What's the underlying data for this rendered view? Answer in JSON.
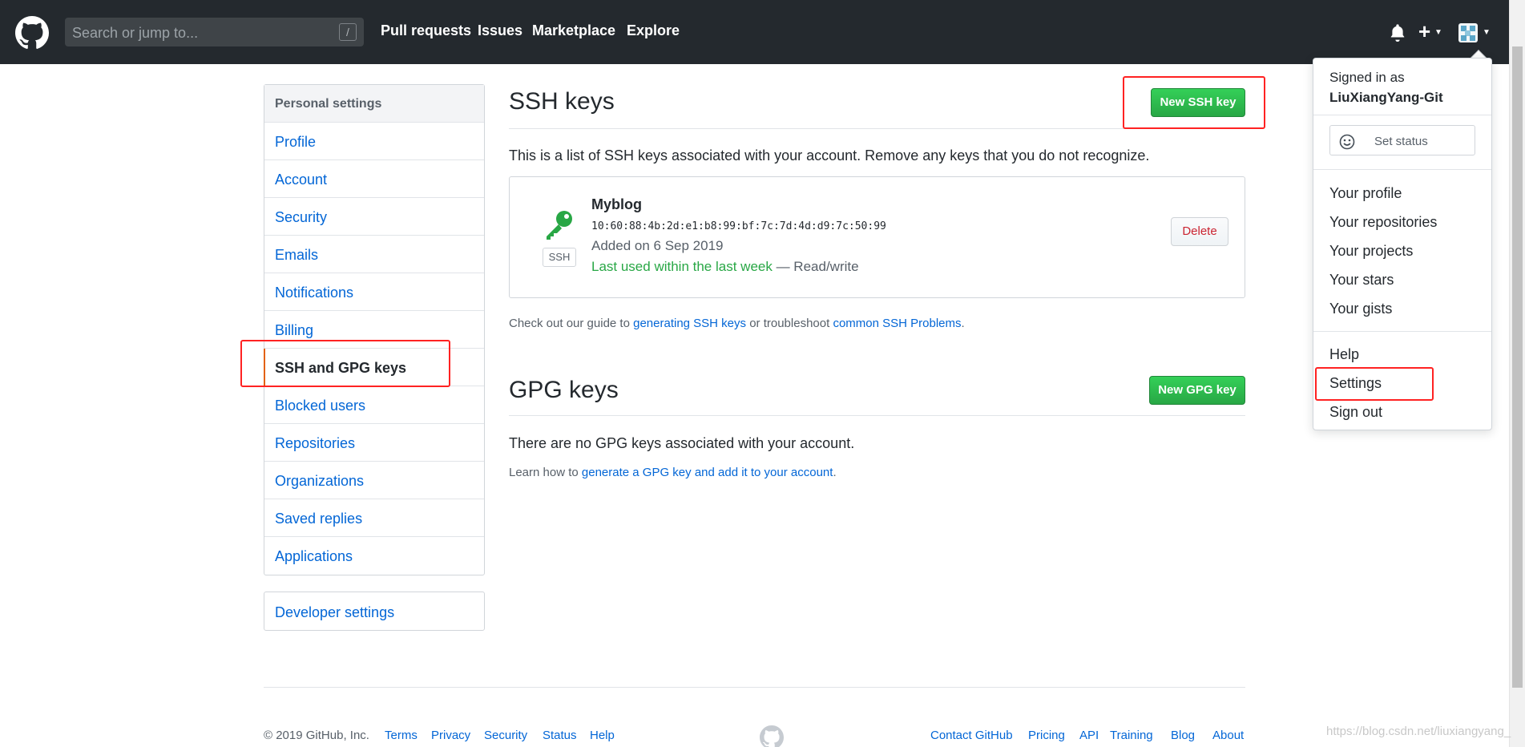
{
  "header": {
    "search_placeholder": "Search or jump to...",
    "search_shortcut": "/",
    "nav": [
      "Pull requests",
      "Issues",
      "Marketplace",
      "Explore"
    ],
    "add_label": "+"
  },
  "sidebar": {
    "heading": "Personal settings",
    "items": [
      {
        "label": "Profile"
      },
      {
        "label": "Account"
      },
      {
        "label": "Security"
      },
      {
        "label": "Emails"
      },
      {
        "label": "Notifications"
      },
      {
        "label": "Billing"
      },
      {
        "label": "SSH and GPG keys",
        "selected": true
      },
      {
        "label": "Blocked users"
      },
      {
        "label": "Repositories"
      },
      {
        "label": "Organizations"
      },
      {
        "label": "Saved replies"
      },
      {
        "label": "Applications"
      }
    ],
    "developer_settings": "Developer settings"
  },
  "ssh": {
    "title": "SSH keys",
    "new_button": "New SSH key",
    "description": "This is a list of SSH keys associated with your account. Remove any keys that you do not recognize.",
    "key": {
      "badge": "SSH",
      "name": "Myblog",
      "fingerprint": "10:60:88:4b:2d:e1:b8:99:bf:7c:7d:4d:d9:7c:50:99",
      "added": "Added on 6 Sep 2019",
      "last_used": "Last used within the last week",
      "access": " — Read/write",
      "delete_label": "Delete"
    },
    "guide_prefix": "Check out our guide to ",
    "guide_link1": "generating SSH keys",
    "guide_middle": " or troubleshoot ",
    "guide_link2": "common SSH Problems",
    "guide_suffix": "."
  },
  "gpg": {
    "title": "GPG keys",
    "new_button": "New GPG key",
    "empty": "There are no GPG keys associated with your account.",
    "learn_prefix": "Learn how to ",
    "learn_link": "generate a GPG key and add it to your account",
    "learn_suffix": "."
  },
  "footer": {
    "copyright": "© 2019 GitHub, Inc.",
    "left_links": [
      "Terms",
      "Privacy",
      "Security",
      "Status",
      "Help"
    ],
    "right_links": [
      "Contact GitHub",
      "Pricing",
      "API",
      "Training",
      "Blog",
      "About"
    ],
    "watermark": "https://blog.csdn.net/liuxiangyang_"
  },
  "dropdown": {
    "signed_in_label": "Signed in as",
    "username": "LiuXiangYang-Git",
    "set_status": "Set status",
    "group1": [
      "Your profile",
      "Your repositories",
      "Your projects",
      "Your stars",
      "Your gists"
    ],
    "group2": [
      "Help",
      "Settings",
      "Sign out"
    ]
  },
  "colors": {
    "header_bg": "#24292e",
    "link": "#0366d6",
    "green_button": "#28a745",
    "delete_text": "#cb2431",
    "selected_marker": "#e36209",
    "annotation_red": "#ff2222"
  }
}
